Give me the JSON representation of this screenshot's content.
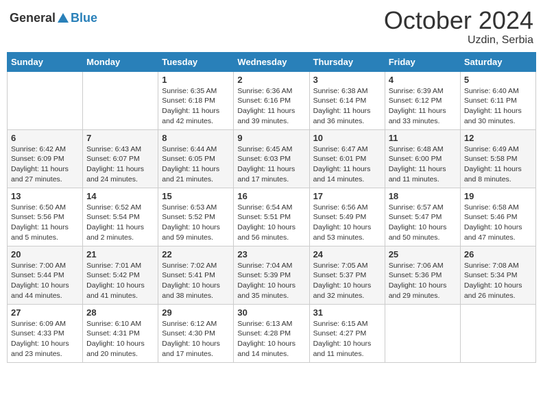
{
  "header": {
    "logo_general": "General",
    "logo_blue": "Blue",
    "month_title": "October 2024",
    "location": "Uzdin, Serbia"
  },
  "weekdays": [
    "Sunday",
    "Monday",
    "Tuesday",
    "Wednesday",
    "Thursday",
    "Friday",
    "Saturday"
  ],
  "weeks": [
    [
      {
        "day": "",
        "info": ""
      },
      {
        "day": "",
        "info": ""
      },
      {
        "day": "1",
        "info": "Sunrise: 6:35 AM\nSunset: 6:18 PM\nDaylight: 11 hours and 42 minutes."
      },
      {
        "day": "2",
        "info": "Sunrise: 6:36 AM\nSunset: 6:16 PM\nDaylight: 11 hours and 39 minutes."
      },
      {
        "day": "3",
        "info": "Sunrise: 6:38 AM\nSunset: 6:14 PM\nDaylight: 11 hours and 36 minutes."
      },
      {
        "day": "4",
        "info": "Sunrise: 6:39 AM\nSunset: 6:12 PM\nDaylight: 11 hours and 33 minutes."
      },
      {
        "day": "5",
        "info": "Sunrise: 6:40 AM\nSunset: 6:11 PM\nDaylight: 11 hours and 30 minutes."
      }
    ],
    [
      {
        "day": "6",
        "info": "Sunrise: 6:42 AM\nSunset: 6:09 PM\nDaylight: 11 hours and 27 minutes."
      },
      {
        "day": "7",
        "info": "Sunrise: 6:43 AM\nSunset: 6:07 PM\nDaylight: 11 hours and 24 minutes."
      },
      {
        "day": "8",
        "info": "Sunrise: 6:44 AM\nSunset: 6:05 PM\nDaylight: 11 hours and 21 minutes."
      },
      {
        "day": "9",
        "info": "Sunrise: 6:45 AM\nSunset: 6:03 PM\nDaylight: 11 hours and 17 minutes."
      },
      {
        "day": "10",
        "info": "Sunrise: 6:47 AM\nSunset: 6:01 PM\nDaylight: 11 hours and 14 minutes."
      },
      {
        "day": "11",
        "info": "Sunrise: 6:48 AM\nSunset: 6:00 PM\nDaylight: 11 hours and 11 minutes."
      },
      {
        "day": "12",
        "info": "Sunrise: 6:49 AM\nSunset: 5:58 PM\nDaylight: 11 hours and 8 minutes."
      }
    ],
    [
      {
        "day": "13",
        "info": "Sunrise: 6:50 AM\nSunset: 5:56 PM\nDaylight: 11 hours and 5 minutes."
      },
      {
        "day": "14",
        "info": "Sunrise: 6:52 AM\nSunset: 5:54 PM\nDaylight: 11 hours and 2 minutes."
      },
      {
        "day": "15",
        "info": "Sunrise: 6:53 AM\nSunset: 5:52 PM\nDaylight: 10 hours and 59 minutes."
      },
      {
        "day": "16",
        "info": "Sunrise: 6:54 AM\nSunset: 5:51 PM\nDaylight: 10 hours and 56 minutes."
      },
      {
        "day": "17",
        "info": "Sunrise: 6:56 AM\nSunset: 5:49 PM\nDaylight: 10 hours and 53 minutes."
      },
      {
        "day": "18",
        "info": "Sunrise: 6:57 AM\nSunset: 5:47 PM\nDaylight: 10 hours and 50 minutes."
      },
      {
        "day": "19",
        "info": "Sunrise: 6:58 AM\nSunset: 5:46 PM\nDaylight: 10 hours and 47 minutes."
      }
    ],
    [
      {
        "day": "20",
        "info": "Sunrise: 7:00 AM\nSunset: 5:44 PM\nDaylight: 10 hours and 44 minutes."
      },
      {
        "day": "21",
        "info": "Sunrise: 7:01 AM\nSunset: 5:42 PM\nDaylight: 10 hours and 41 minutes."
      },
      {
        "day": "22",
        "info": "Sunrise: 7:02 AM\nSunset: 5:41 PM\nDaylight: 10 hours and 38 minutes."
      },
      {
        "day": "23",
        "info": "Sunrise: 7:04 AM\nSunset: 5:39 PM\nDaylight: 10 hours and 35 minutes."
      },
      {
        "day": "24",
        "info": "Sunrise: 7:05 AM\nSunset: 5:37 PM\nDaylight: 10 hours and 32 minutes."
      },
      {
        "day": "25",
        "info": "Sunrise: 7:06 AM\nSunset: 5:36 PM\nDaylight: 10 hours and 29 minutes."
      },
      {
        "day": "26",
        "info": "Sunrise: 7:08 AM\nSunset: 5:34 PM\nDaylight: 10 hours and 26 minutes."
      }
    ],
    [
      {
        "day": "27",
        "info": "Sunrise: 6:09 AM\nSunset: 4:33 PM\nDaylight: 10 hours and 23 minutes."
      },
      {
        "day": "28",
        "info": "Sunrise: 6:10 AM\nSunset: 4:31 PM\nDaylight: 10 hours and 20 minutes."
      },
      {
        "day": "29",
        "info": "Sunrise: 6:12 AM\nSunset: 4:30 PM\nDaylight: 10 hours and 17 minutes."
      },
      {
        "day": "30",
        "info": "Sunrise: 6:13 AM\nSunset: 4:28 PM\nDaylight: 10 hours and 14 minutes."
      },
      {
        "day": "31",
        "info": "Sunrise: 6:15 AM\nSunset: 4:27 PM\nDaylight: 10 hours and 11 minutes."
      },
      {
        "day": "",
        "info": ""
      },
      {
        "day": "",
        "info": ""
      }
    ]
  ]
}
